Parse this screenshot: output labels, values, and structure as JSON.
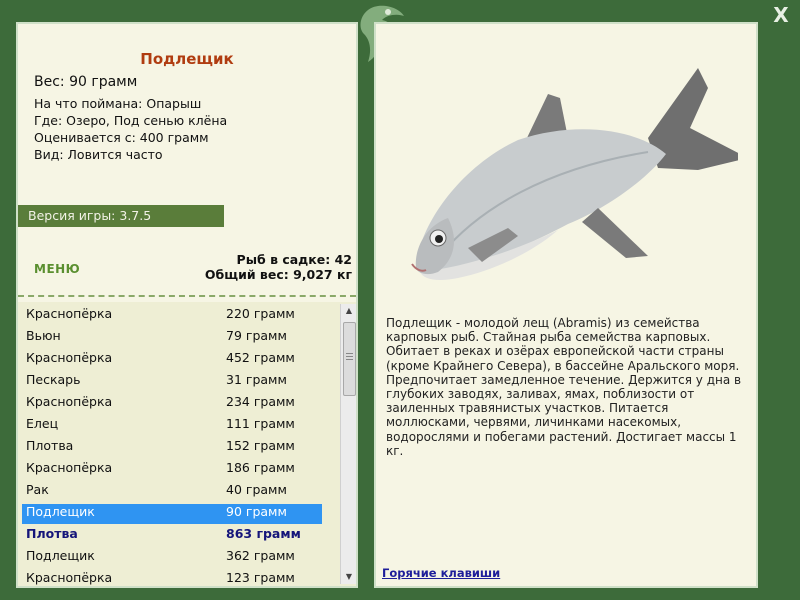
{
  "window": {
    "close_symbol": "X"
  },
  "fish": {
    "name": "Подлещик",
    "weight": "Вес: 90 грамм",
    "info": [
      "На что поймана: Опарыш",
      "Где: Озеро, Под сенью клёна",
      "Оценивается с: 400 грамм",
      "Вид: Ловится часто"
    ],
    "description": "Подлещик - молодой лещ (Abramis) из семейства карповых рыб. Стайная рыба семейства карповых. Обитает в реках и озёрах европейской части страны (кроме Крайнего Севера), в бассейне Аральского моря. Предпочитает замедленное течение. Держится у дна в глубоких заводях, заливах, ямах, поблизости от заиленных травянистых участков. Питается моллюсками, червями, личинками насекомых, водорослями и побегами растений. Достигает массы 1 кг."
  },
  "version": "Версия игры: 3.7.5",
  "menu_label": "МЕНЮ",
  "stats": {
    "fish_in_keepnet": "Рыб в садке: 42",
    "total_weight": "Общий вес: 9,027 кг"
  },
  "catch_list": [
    {
      "name": "Краснопёрка",
      "weight": "220 грамм"
    },
    {
      "name": "Вьюн",
      "weight": "79 грамм"
    },
    {
      "name": "Краснопёрка",
      "weight": "452 грамм"
    },
    {
      "name": "Пескарь",
      "weight": "31 грамм"
    },
    {
      "name": "Краснопёрка",
      "weight": "234 грамм"
    },
    {
      "name": "Елец",
      "weight": "111 грамм"
    },
    {
      "name": "Плотва",
      "weight": "152 грамм"
    },
    {
      "name": "Краснопёрка",
      "weight": "186 грамм"
    },
    {
      "name": "Рак",
      "weight": "40 грамм"
    },
    {
      "name": "Подлещик",
      "weight": "90 грамм",
      "selected": true
    },
    {
      "name": "Плотва",
      "weight": "863 грамм",
      "bold": true
    },
    {
      "name": "Подлещик",
      "weight": "362 грамм"
    },
    {
      "name": "Краснопёрка",
      "weight": "123 грамм"
    }
  ],
  "hotkeys_label": "Горячие клавиши",
  "colors": {
    "background": "#3d6b3a",
    "panel": "#f6f5e4",
    "title": "#b03c10",
    "selection": "#2f94f2",
    "link": "#1e1e9a"
  }
}
